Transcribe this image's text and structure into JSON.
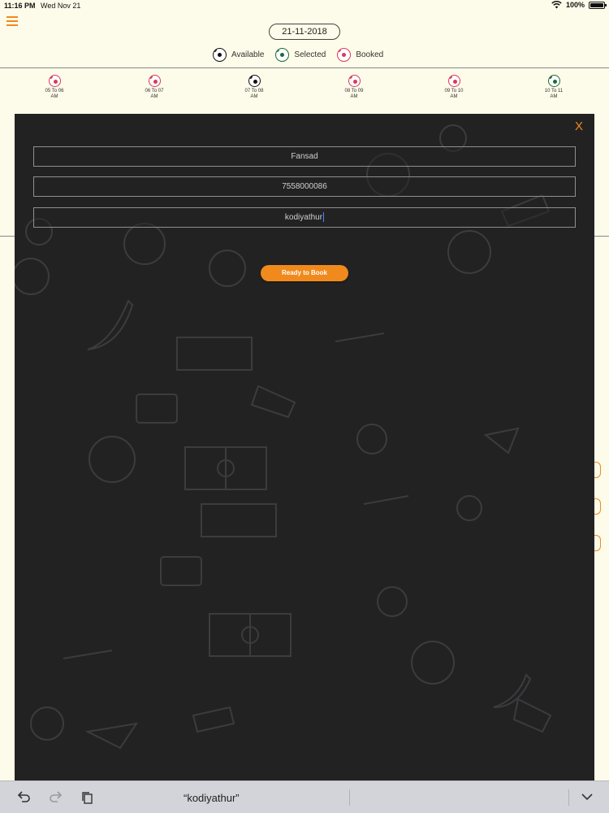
{
  "status_bar": {
    "time": "11:16 PM",
    "date": "Wed Nov 21",
    "battery": "100%"
  },
  "header": {
    "date": "21-11-2018"
  },
  "legend": [
    {
      "label": "Available",
      "state": "available"
    },
    {
      "label": "Selected",
      "state": "selected"
    },
    {
      "label": "Booked",
      "state": "booked"
    }
  ],
  "slots": [
    {
      "label_line1": "05 To 06",
      "label_line2": "AM",
      "state": "booked"
    },
    {
      "label_line1": "06 To 07",
      "label_line2": "AM",
      "state": "booked"
    },
    {
      "label_line1": "07 To 08",
      "label_line2": "AM",
      "state": "available"
    },
    {
      "label_line1": "08 To 09",
      "label_line2": "AM",
      "state": "booked"
    },
    {
      "label_line1": "09 To 10",
      "label_line2": "AM",
      "state": "booked"
    },
    {
      "label_line1": "10 To 11",
      "label_line2": "AM",
      "state": "selected"
    }
  ],
  "modal": {
    "close_label": "X",
    "name_value": "Fansad",
    "phone_value": "7558000086",
    "place_value": "kodiyathur",
    "book_button": "Ready to Book"
  },
  "keyboard_bar": {
    "suggestion": "“kodiyathur”"
  },
  "colors": {
    "accent": "#f08a1c",
    "modal_bg": "#232223",
    "page_bg": "#fdfbe9"
  }
}
